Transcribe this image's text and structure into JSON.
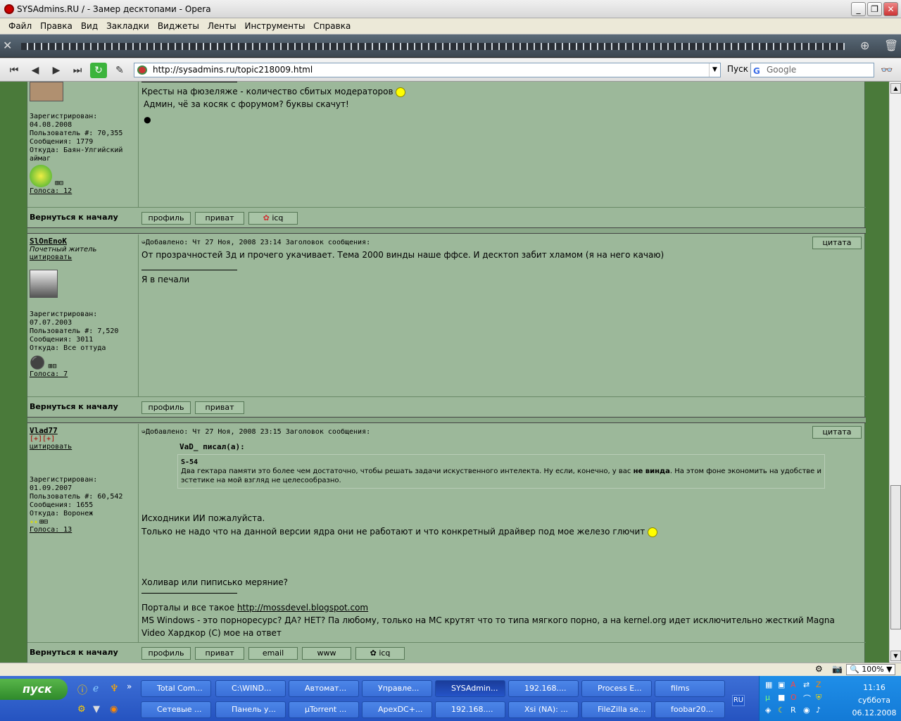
{
  "window": {
    "title": "SYSAdmins.RU / - Замер десктопами - Opera",
    "controls": {
      "minimize": "_",
      "maximize": "❐",
      "close": "✕"
    }
  },
  "menu": [
    "Файл",
    "Правка",
    "Вид",
    "Закладки",
    "Виджеты",
    "Ленты",
    "Инструменты",
    "Справка"
  ],
  "address": {
    "url": "http://sysadmins.ru/topic218009.html",
    "search_label": "Пуск",
    "search_placeholder": "Google"
  },
  "posts": [
    {
      "user": {
        "info": [
          "Зарегистрирован:",
          "04.08.2008",
          "Пользователь #: 70,355",
          "Сообщения: 1779",
          "Откуда: Баян-Улгийский",
          "аймаг"
        ],
        "votes": "Голоса: 12"
      },
      "body": [
        "Кресты на фюзеляже - количество сбитых модераторов",
        "Админ, чё за косяк с форумом? буквы скачут!"
      ],
      "back": "Вернуться к началу",
      "buttons": [
        "профиль",
        "приват",
        "icq"
      ]
    },
    {
      "user": {
        "name": "SlOnEnoK",
        "title": "Почетный житель",
        "quote_link": "цитировать",
        "info": [
          "Зарегистрирован:",
          "07.07.2003",
          "Пользователь #: 7,520",
          "Сообщения: 3011",
          "Откуда: Все оттуда"
        ],
        "votes": "Голоса: 7"
      },
      "meta": "Добавлено: Чт 27 Ноя, 2008 23:14   Заголовок сообщения:",
      "quote_btn": "цитата",
      "body": [
        "От прозрачностей 3д и прочего укачивает. Тема 2000 винды наше ффсе. И десктоп забит хламом (я на него качаю)"
      ],
      "signature": "Я в печали",
      "back": "Вернуться к началу",
      "buttons": [
        "профиль",
        "приват"
      ]
    },
    {
      "user": {
        "name": "Vlad77",
        "rank": "[+][+]",
        "quote_link": "цитировать",
        "info": [
          "Зарегистрирован:",
          "01.09.2007",
          "Пользователь #: 60,542",
          "Сообщения: 1655",
          "Откуда: Воронеж"
        ],
        "votes": "Голоса: 13"
      },
      "meta": "Добавлено: Чт 27 Ноя, 2008 23:15   Заголовок сообщения:",
      "quote_btn": "цитата",
      "quote_author": "VaD_ писал(а):",
      "quote_title": "S-54",
      "quote_text_1": "Два гектара памяти это более чем достаточно, чтобы решать задачи искуственного интелекта. Ну если, конечно, у вас",
      "quote_bold": "не винда",
      "quote_text_2": ". На этом фоне экономить на удобстве и эстетике на мой взгляд не целесообразно.",
      "body": [
        "Исходники ИИ пожалуйста.",
        "Только не надо что на данной версии ядра они не работают и что конкретный драйвер под мое железо глючит",
        "Холивар или пиписько меряние?"
      ],
      "sig_prefix": "Порталы и все такое ",
      "sig_link": "http://mossdevel.blogspot.com",
      "sig_line2": "MS Windows - это порноресурс? ДА? НЕТ? Па любому, только на МС крутят что то типа мягкого порно, а на kernel.org идет исключительно жесткий Magna Video Хардкор (С) мое на ответ",
      "back": "Вернуться к началу",
      "buttons": [
        "профиль",
        "приват",
        "email",
        "www",
        "icq"
      ]
    }
  ],
  "status": {
    "zoom": "100%"
  },
  "taskbar": {
    "start": "пуск",
    "row1": [
      "Total Com...",
      "C:\\WIND...",
      "Автомат...",
      "Управле...",
      "SYSAdmin...",
      "192.168....",
      "Process E...",
      "films"
    ],
    "row2": [
      "Сетевые ...",
      "Панель у...",
      "µTorrent ...",
      "ApexDC+...",
      "192.168....",
      "Xsi (NA): ...",
      "FileZilla se...",
      "foobar20..."
    ],
    "lang": "RU",
    "time": "11:16",
    "day": "суббота",
    "date": "06.12.2008"
  }
}
